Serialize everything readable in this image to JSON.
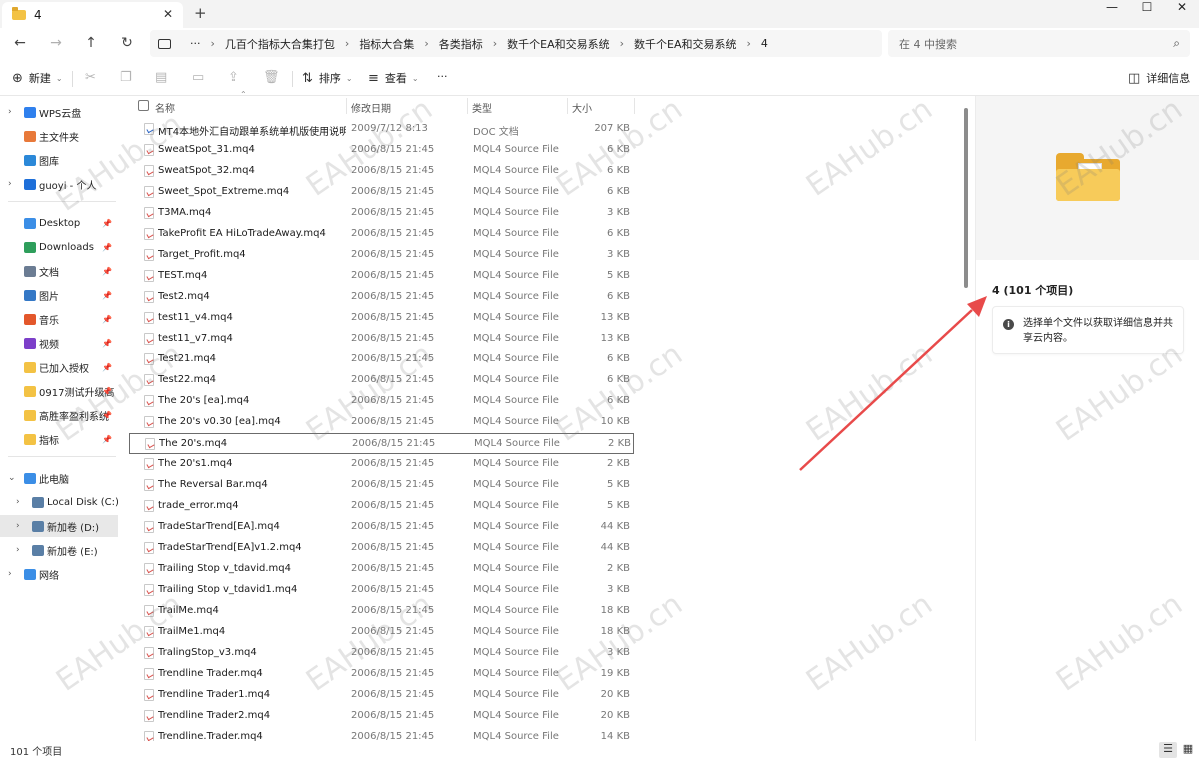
{
  "window": {
    "tab_title": "4",
    "tab_close": "✕",
    "new_tab": "+",
    "minimize": "—",
    "maximize": "☐",
    "close": "✕"
  },
  "nav": {
    "back": "←",
    "forward": "→",
    "up": "↑",
    "refresh": "↻"
  },
  "address": {
    "more": "···",
    "crumbs": [
      "几百个指标大合集打包",
      "指标大合集",
      "各类指标",
      "数千个EA和交易系统",
      "数千个EA和交易系统",
      "4"
    ],
    "separator": "›"
  },
  "search": {
    "placeholder": "在 4 中搜索",
    "icon": "search-icon"
  },
  "toolbar": {
    "new_label": "新建",
    "sort_label": "排序",
    "view_label": "查看",
    "more_label": "···",
    "details_label": "详细信息"
  },
  "sidebar": {
    "groups": [
      [
        {
          "label": "WPS云盘",
          "icon": "cloud-icon",
          "color": "#2f80ed",
          "expandable": true
        },
        {
          "label": "主文件夹",
          "icon": "home-icon",
          "color": "#e8793a",
          "expandable": false
        },
        {
          "label": "图库",
          "icon": "gallery-icon",
          "color": "#2b88d8",
          "expandable": false
        },
        {
          "label": "guoyi - 个人",
          "icon": "onedrive-icon",
          "color": "#1e6fd9",
          "expandable": true
        }
      ],
      [
        {
          "label": "Desktop",
          "icon": "desktop-icon",
          "color": "#3b8ee6",
          "pinned": true
        },
        {
          "label": "Downloads",
          "icon": "download-icon",
          "color": "#2e9e5b",
          "pinned": true
        },
        {
          "label": "文档",
          "icon": "documents-icon",
          "color": "#6b7c93",
          "pinned": true
        },
        {
          "label": "图片",
          "icon": "pictures-icon",
          "color": "#3478c6",
          "pinned": true
        },
        {
          "label": "音乐",
          "icon": "music-icon",
          "color": "#e3572b",
          "pinned": true
        },
        {
          "label": "视频",
          "icon": "video-icon",
          "color": "#7c3fc9",
          "pinned": true
        },
        {
          "label": "已加入授权",
          "icon": "folder-icon",
          "color": "#f3c244",
          "pinned": true
        },
        {
          "label": "0917测试升级高",
          "icon": "folder-icon",
          "color": "#f3c244",
          "pinned": true
        },
        {
          "label": "高胜率盈利系统",
          "icon": "folder-icon",
          "color": "#f3c244",
          "pinned": true
        },
        {
          "label": "指标",
          "icon": "folder-icon",
          "color": "#f3c244",
          "pinned": true
        }
      ],
      [
        {
          "label": "此电脑",
          "icon": "pc-icon",
          "color": "#3b8ee6",
          "expandable": true,
          "expanded": true
        },
        {
          "label": "Local Disk (C:)",
          "icon": "drive-icon",
          "color": "#5a7fa6",
          "expandable": true,
          "indent": true
        },
        {
          "label": "新加卷 (D:)",
          "icon": "drive-icon",
          "color": "#5a7fa6",
          "expandable": true,
          "indent": true,
          "selected": true
        },
        {
          "label": "新加卷 (E:)",
          "icon": "drive-icon",
          "color": "#5a7fa6",
          "expandable": true,
          "indent": true
        },
        {
          "label": "网络",
          "icon": "network-icon",
          "color": "#3b8ee6",
          "expandable": true
        }
      ]
    ]
  },
  "columns": {
    "name": "名称",
    "date": "修改日期",
    "type": "类型",
    "size": "大小"
  },
  "files": [
    {
      "name": "MT4本地外汇自动跟单系统单机版使用说明...",
      "date": "2009/7/12 8:13",
      "type": "DOC 文档",
      "size": "207 KB",
      "doc": true
    },
    {
      "name": "SweatSpot_31.mq4",
      "date": "2006/8/15 21:45",
      "type": "MQL4 Source File",
      "size": "6 KB"
    },
    {
      "name": "SweatSpot_32.mq4",
      "date": "2006/8/15 21:45",
      "type": "MQL4 Source File",
      "size": "6 KB"
    },
    {
      "name": "Sweet_Spot_Extreme.mq4",
      "date": "2006/8/15 21:45",
      "type": "MQL4 Source File",
      "size": "6 KB"
    },
    {
      "name": "T3MA.mq4",
      "date": "2006/8/15 21:45",
      "type": "MQL4 Source File",
      "size": "3 KB"
    },
    {
      "name": "TakeProfit EA HiLoTradeAway.mq4",
      "date": "2006/8/15 21:45",
      "type": "MQL4 Source File",
      "size": "6 KB"
    },
    {
      "name": "Target_Profit.mq4",
      "date": "2006/8/15 21:45",
      "type": "MQL4 Source File",
      "size": "3 KB"
    },
    {
      "name": "TEST.mq4",
      "date": "2006/8/15 21:45",
      "type": "MQL4 Source File",
      "size": "5 KB"
    },
    {
      "name": "Test2.mq4",
      "date": "2006/8/15 21:45",
      "type": "MQL4 Source File",
      "size": "6 KB"
    },
    {
      "name": "test11_v4.mq4",
      "date": "2006/8/15 21:45",
      "type": "MQL4 Source File",
      "size": "13 KB"
    },
    {
      "name": "test11_v7.mq4",
      "date": "2006/8/15 21:45",
      "type": "MQL4 Source File",
      "size": "13 KB"
    },
    {
      "name": "Test21.mq4",
      "date": "2006/8/15 21:45",
      "type": "MQL4 Source File",
      "size": "6 KB"
    },
    {
      "name": "Test22.mq4",
      "date": "2006/8/15 21:45",
      "type": "MQL4 Source File",
      "size": "6 KB"
    },
    {
      "name": "The 20's [ea].mq4",
      "date": "2006/8/15 21:45",
      "type": "MQL4 Source File",
      "size": "6 KB"
    },
    {
      "name": "The 20's v0.30 [ea].mq4",
      "date": "2006/8/15 21:45",
      "type": "MQL4 Source File",
      "size": "10 KB"
    },
    {
      "name": "The 20's.mq4",
      "date": "2006/8/15 21:45",
      "type": "MQL4 Source File",
      "size": "2 KB",
      "focus": true
    },
    {
      "name": "The 20's1.mq4",
      "date": "2006/8/15 21:45",
      "type": "MQL4 Source File",
      "size": "2 KB"
    },
    {
      "name": "The Reversal Bar.mq4",
      "date": "2006/8/15 21:45",
      "type": "MQL4 Source File",
      "size": "5 KB"
    },
    {
      "name": "trade_error.mq4",
      "date": "2006/8/15 21:45",
      "type": "MQL4 Source File",
      "size": "5 KB"
    },
    {
      "name": "TradeStarTrend[EA].mq4",
      "date": "2006/8/15 21:45",
      "type": "MQL4 Source File",
      "size": "44 KB"
    },
    {
      "name": "TradeStarTrend[EA]v1.2.mq4",
      "date": "2006/8/15 21:45",
      "type": "MQL4 Source File",
      "size": "44 KB"
    },
    {
      "name": "Trailing Stop v_tdavid.mq4",
      "date": "2006/8/15 21:45",
      "type": "MQL4 Source File",
      "size": "2 KB"
    },
    {
      "name": "Trailing Stop v_tdavid1.mq4",
      "date": "2006/8/15 21:45",
      "type": "MQL4 Source File",
      "size": "3 KB"
    },
    {
      "name": "TrailMe.mq4",
      "date": "2006/8/15 21:45",
      "type": "MQL4 Source File",
      "size": "18 KB"
    },
    {
      "name": "TrailMe1.mq4",
      "date": "2006/8/15 21:45",
      "type": "MQL4 Source File",
      "size": "18 KB"
    },
    {
      "name": "TralingStop_v3.mq4",
      "date": "2006/8/15 21:45",
      "type": "MQL4 Source File",
      "size": "3 KB"
    },
    {
      "name": "Trendline Trader.mq4",
      "date": "2006/8/15 21:45",
      "type": "MQL4 Source File",
      "size": "19 KB"
    },
    {
      "name": "Trendline Trader1.mq4",
      "date": "2006/8/15 21:45",
      "type": "MQL4 Source File",
      "size": "20 KB"
    },
    {
      "name": "Trendline Trader2.mq4",
      "date": "2006/8/15 21:45",
      "type": "MQL4 Source File",
      "size": "20 KB"
    },
    {
      "name": "Trendline.Trader.mq4",
      "date": "2006/8/15 21:45",
      "type": "MQL4 Source File",
      "size": "14 KB"
    }
  ],
  "details": {
    "title": "4 (101 个项目)",
    "info": "选择单个文件以获取详细信息并共享云内容。",
    "info_icon": "i"
  },
  "status": {
    "count": "101 个项目"
  },
  "watermark": "EAHub.cn",
  "colors": {
    "accent": "#e8a92f",
    "arrow": "#e84a4a",
    "folder": "#f3c244"
  }
}
